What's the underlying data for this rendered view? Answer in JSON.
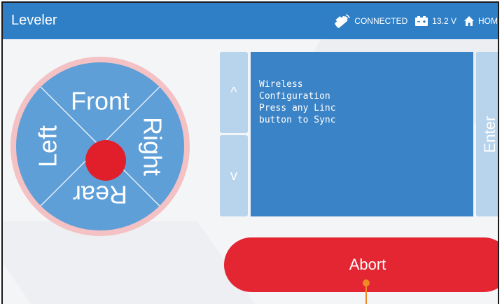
{
  "app": {
    "title": "Leveler"
  },
  "status": {
    "connection": "CONNECTED",
    "battery": "13.2 V",
    "home": "HOM"
  },
  "joystick": {
    "front": "Front",
    "right": "Right",
    "rear": "Rear",
    "left": "Left"
  },
  "controls": {
    "up": "^",
    "down": "v",
    "enter": "Enter",
    "abort": "Abort"
  },
  "display": {
    "lines": "Wireless\nConfiguration\nPress any Linc\nbutton to Sync"
  },
  "colors": {
    "topbar": "#2f7fc6",
    "panel": "#3b83c7",
    "joystick": "#5f9fd8",
    "ring": "#f4c1c4",
    "center": "#e11f2b",
    "abort": "#e32631",
    "side_buttons": "#b8d3ec",
    "callout": "#f08a26"
  }
}
